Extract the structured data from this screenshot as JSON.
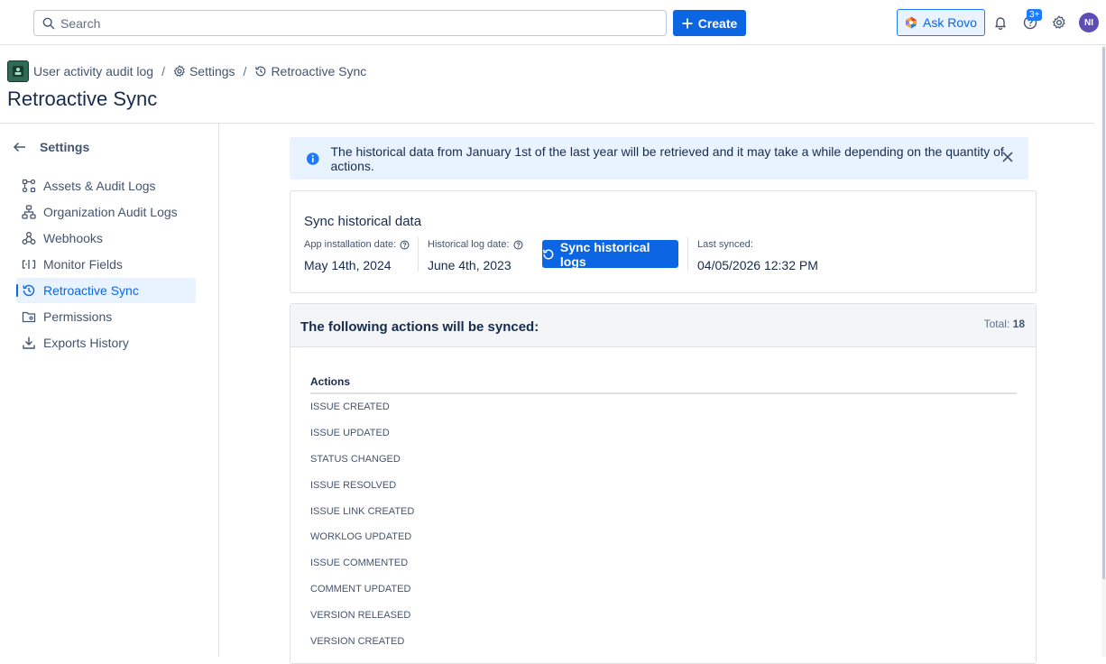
{
  "topbar": {
    "search_placeholder": "Search",
    "create_label": "Create",
    "rovo_label": "Ask Rovo",
    "badge": "3+",
    "avatar_initials": "NI"
  },
  "breadcrumb": {
    "app": "User activity audit log",
    "settings": "Settings",
    "current": "Retroactive Sync"
  },
  "page_title": "Retroactive Sync",
  "sidebar": {
    "heading": "Settings",
    "items": [
      {
        "label": "Assets & Audit Logs",
        "icon": "assets-icon",
        "active": false
      },
      {
        "label": "Organization Audit Logs",
        "icon": "org-tree-icon",
        "active": false
      },
      {
        "label": "Webhooks",
        "icon": "webhook-icon",
        "active": false
      },
      {
        "label": "Monitor Fields",
        "icon": "monitor-fields-icon",
        "active": false
      },
      {
        "label": "Retroactive Sync",
        "icon": "history-icon",
        "active": true
      },
      {
        "label": "Permissions",
        "icon": "permissions-icon",
        "active": false
      },
      {
        "label": "Exports History",
        "icon": "download-icon",
        "active": false
      }
    ]
  },
  "banner": {
    "text": "The historical data from January 1st of the last year will be retrieved and it may take a while depending on the quantity of actions."
  },
  "sync_card": {
    "title": "Sync historical data",
    "install_label": "App installation date:",
    "install_value": "May 14th, 2024",
    "log_label": "Historical log date:",
    "log_value": "June 4th, 2023",
    "button_label": "Sync historical logs",
    "last_synced_label": "Last synced:",
    "last_synced_value": "04/05/2026 12:32 PM"
  },
  "actions": {
    "title": "The following actions will be synced:",
    "total_label": "Total:",
    "total_value": "18",
    "column_header": "Actions",
    "rows": [
      "ISSUE CREATED",
      "ISSUE UPDATED",
      "STATUS CHANGED",
      "ISSUE RESOLVED",
      "ISSUE LINK CREATED",
      "WORKLOG UPDATED",
      "ISSUE COMMENTED",
      "COMMENT UPDATED",
      "VERSION RELEASED",
      "VERSION CREATED"
    ]
  },
  "colors": {
    "brand": "#0c66e4",
    "active_bg": "#e9f2ff",
    "banner_bg": "#e9f2ff",
    "avatar": "#5e4db2"
  }
}
